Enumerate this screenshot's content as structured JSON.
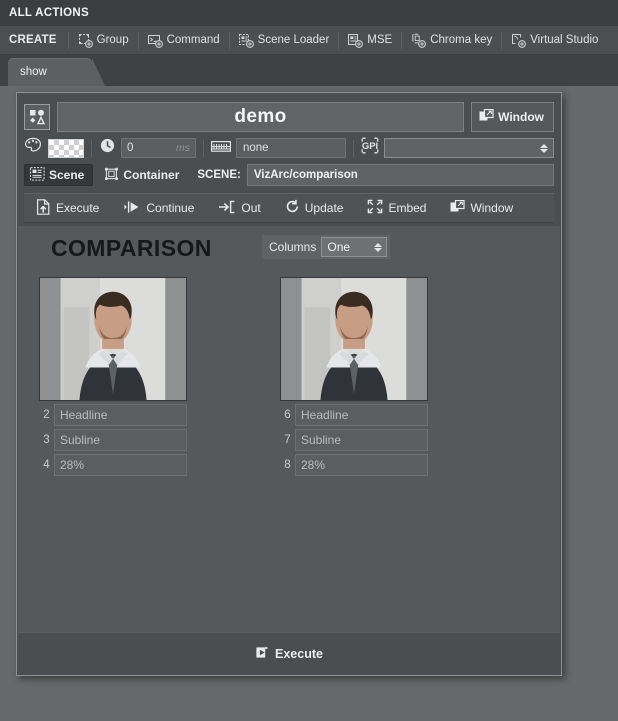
{
  "topbar": {
    "title": "ALL ACTIONS"
  },
  "createbar": {
    "create_label": "CREATE",
    "items": [
      {
        "label": "Group",
        "icon": "group-add-icon"
      },
      {
        "label": "Command",
        "icon": "command-add-icon"
      },
      {
        "label": "Scene Loader",
        "icon": "scene-loader-add-icon"
      },
      {
        "label": "MSE",
        "icon": "mse-add-icon"
      },
      {
        "label": "Chroma key",
        "icon": "chroma-key-add-icon"
      },
      {
        "label": "Virtual Studio",
        "icon": "virtual-studio-add-icon"
      }
    ]
  },
  "tabs": [
    {
      "label": "show",
      "active": true
    }
  ],
  "dialog": {
    "name_value": "demo",
    "name_icon": "shapes-ab-icon",
    "window_button": "Window",
    "props": {
      "color_icon": "palette-icon",
      "color_swatch": "transparent-checker",
      "clock_icon": "clock-icon",
      "delay_value": "0",
      "delay_unit": "ms",
      "keyboard_icon": "keyboard-icon",
      "shortcut_value": "none",
      "gpi_icon": "gpi-icon",
      "gpi_value": ""
    },
    "target": {
      "scene_tab": "Scene",
      "container_tab": "Container",
      "scene_label": "SCENE:",
      "scene_value": "VizArc/comparison"
    },
    "actions": [
      {
        "label": "Execute",
        "icon": "execute-icon"
      },
      {
        "label": "Continue",
        "icon": "continue-icon"
      },
      {
        "label": "Out",
        "icon": "out-icon"
      },
      {
        "label": "Update",
        "icon": "update-icon"
      },
      {
        "label": "Embed",
        "icon": "embed-icon"
      },
      {
        "label": "Window",
        "icon": "window-icon"
      }
    ],
    "content": {
      "title": "COMPARISON",
      "columns_label": "Columns",
      "columns_value": "One",
      "cards": [
        {
          "image_alt": "man-in-suit-portrait",
          "fields": [
            {
              "index": "2",
              "value": "Headline"
            },
            {
              "index": "3",
              "value": "Subline"
            },
            {
              "index": "4",
              "value": "28%"
            }
          ]
        },
        {
          "image_alt": "man-in-suit-portrait",
          "fields": [
            {
              "index": "6",
              "value": "Headline"
            },
            {
              "index": "7",
              "value": "Subline"
            },
            {
              "index": "8",
              "value": "28%"
            }
          ]
        }
      ]
    },
    "footer": {
      "execute_label": "Execute",
      "execute_icon": "execute-icon"
    }
  },
  "colors": {
    "topbar_bg": "#3b3f42",
    "createbar_bg": "#4b4f52",
    "workspace_bg": "#66696b",
    "dialog_bg": "#4a4e51",
    "content_bg": "#56595c",
    "field_bg": "#5a5e61",
    "title_text": "#16181a"
  }
}
